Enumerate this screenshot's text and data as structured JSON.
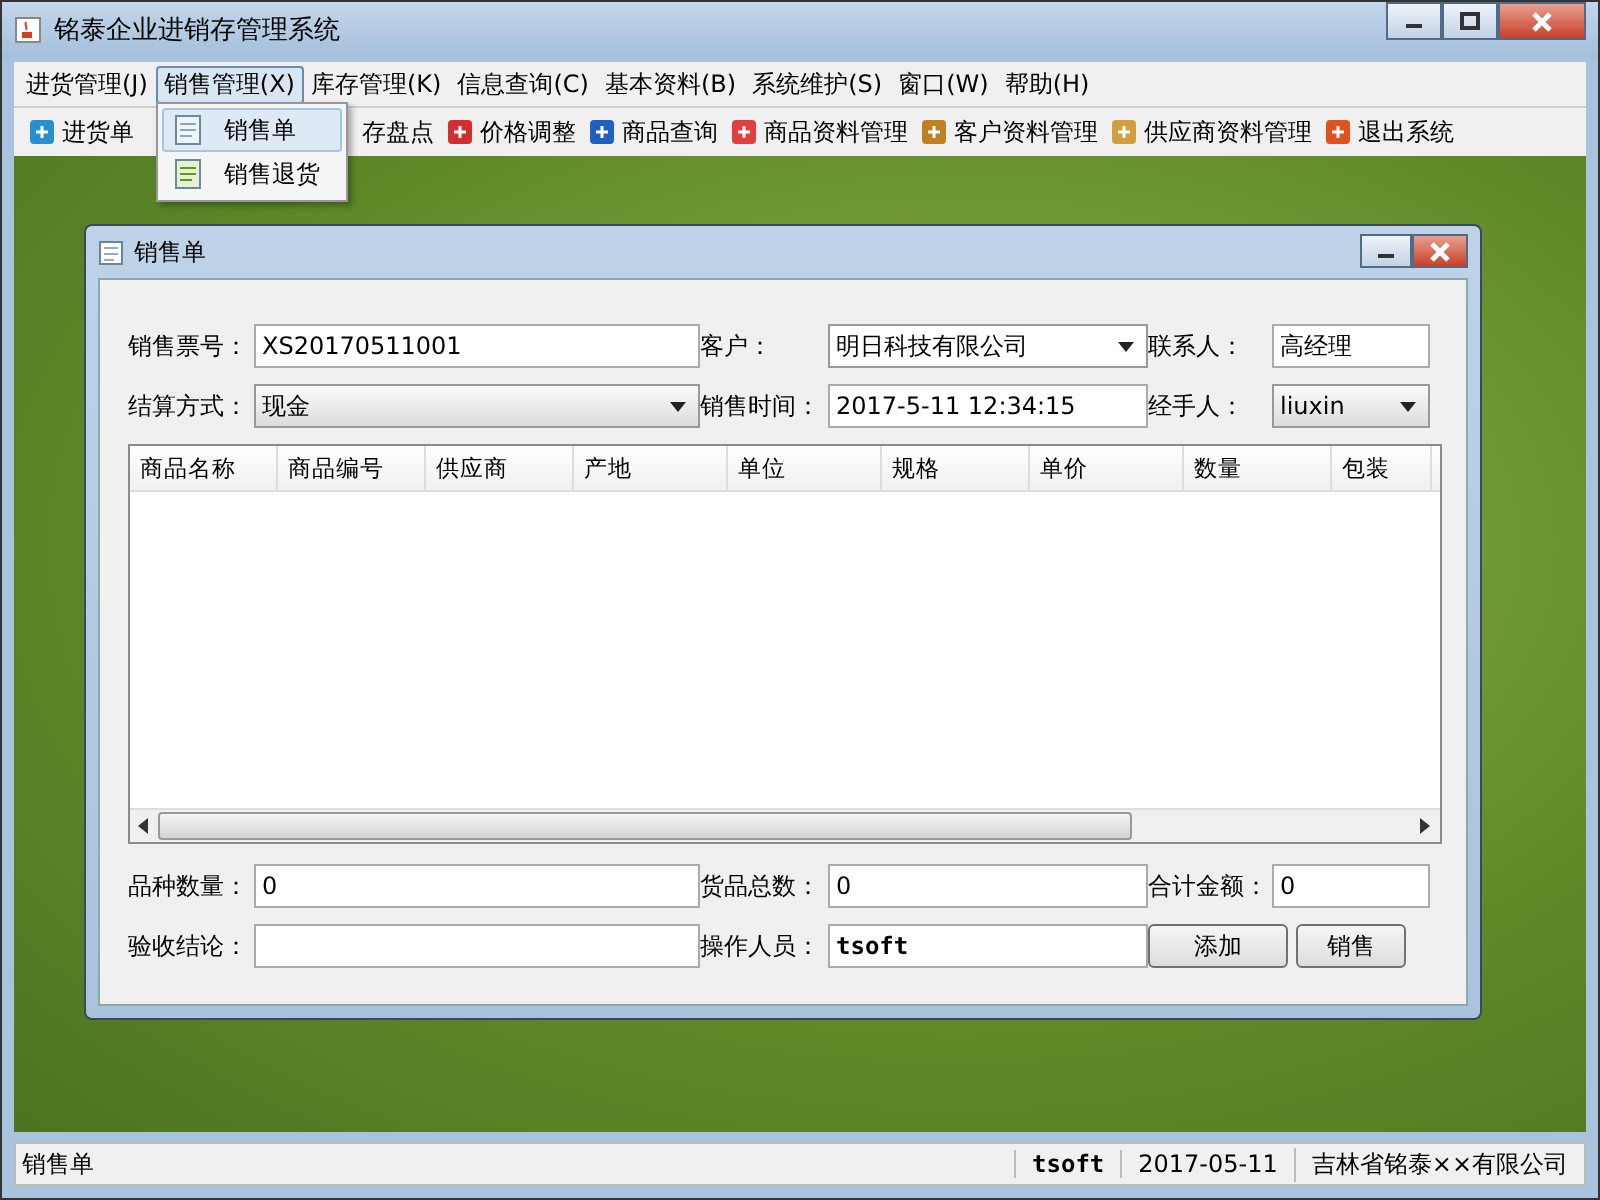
{
  "window": {
    "title": "铭泰企业进销存管理系统"
  },
  "menu": [
    {
      "label": "进货管理(J)",
      "selected": false
    },
    {
      "label": "销售管理(X)",
      "selected": true
    },
    {
      "label": "库存管理(K)",
      "selected": false
    },
    {
      "label": "信息查询(C)",
      "selected": false
    },
    {
      "label": "基本资料(B)",
      "selected": false
    },
    {
      "label": "系统维护(S)",
      "selected": false
    },
    {
      "label": "窗口(W)",
      "selected": false
    },
    {
      "label": "帮助(H)",
      "selected": false
    }
  ],
  "dropdown": [
    {
      "label": "销售单",
      "selected": true
    },
    {
      "label": "销售退货",
      "selected": false
    }
  ],
  "toolbar": [
    {
      "label": "进货单"
    },
    {
      "label": "存盘点"
    },
    {
      "label": "价格调整"
    },
    {
      "label": "商品查询"
    },
    {
      "label": "商品资料管理"
    },
    {
      "label": "客户资料管理"
    },
    {
      "label": "供应商资料管理"
    },
    {
      "label": "退出系统"
    }
  ],
  "sale_window": {
    "title": "销售单",
    "fields": [
      {
        "label": "销售票号：",
        "value": "XS20170511001",
        "kind": "text"
      },
      {
        "label": "客户：",
        "value": "明日科技有限公司",
        "kind": "combo"
      },
      {
        "label": "联系人：",
        "value": "高经理",
        "kind": "text"
      },
      {
        "label": "结算方式：",
        "value": "现金",
        "kind": "combo"
      },
      {
        "label": "销售时间：",
        "value": "2017-5-11 12:34:15",
        "kind": "text"
      },
      {
        "label": "经手人：",
        "value": "liuxin",
        "kind": "combo"
      }
    ],
    "table": {
      "columns": [
        "商品名称",
        "商品编号",
        "供应商",
        "产地",
        "单位",
        "规格",
        "单价",
        "数量",
        "包装"
      ]
    },
    "totals": [
      {
        "label": "品种数量：",
        "value": "0"
      },
      {
        "label": "货品总数：",
        "value": "0"
      },
      {
        "label": "合计金额：",
        "value": "0"
      }
    ],
    "check": {
      "label": "验收结论："
    },
    "operator": {
      "label": "操作人员：",
      "value": "tsoft"
    },
    "buttons": [
      "添加",
      "销售"
    ]
  },
  "status_bar": [
    "销售单",
    "tsoft",
    "2017-05-11",
    "吉林省铭泰××有限公司"
  ]
}
